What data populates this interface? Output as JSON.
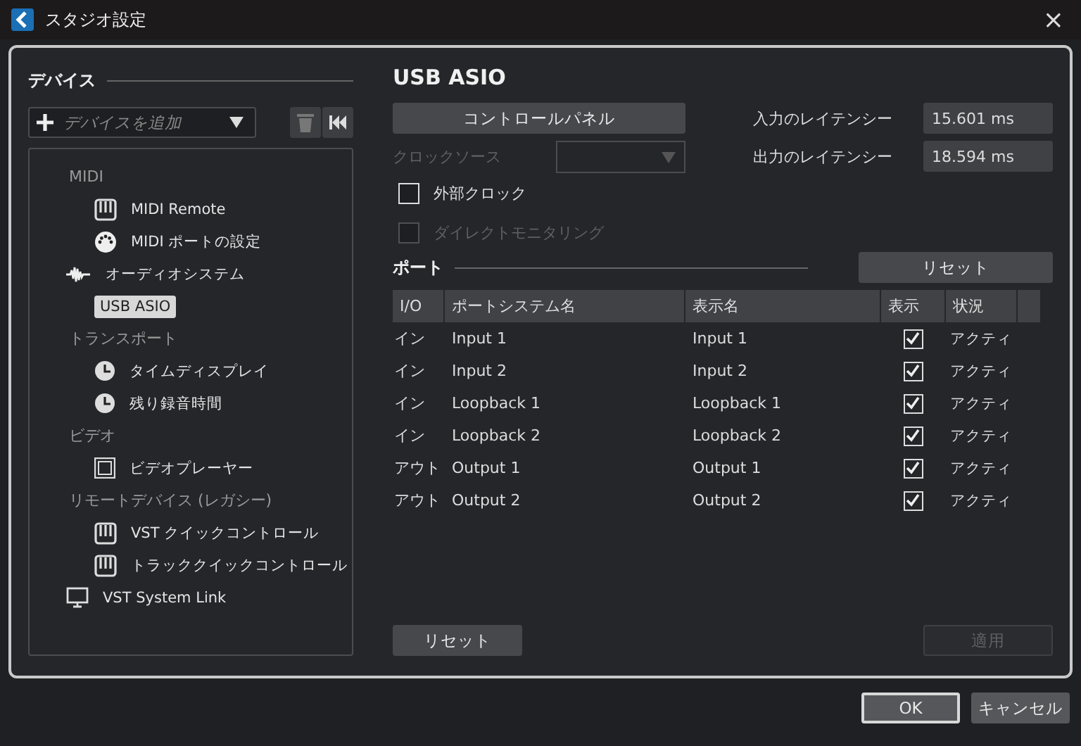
{
  "window": {
    "title": "スタジオ設定",
    "close": "×"
  },
  "devices": {
    "heading": "デバイス",
    "add_placeholder": "デバイスを追加",
    "tree": [
      {
        "label": "MIDI",
        "kind": "category",
        "selected": false,
        "children": [
          {
            "label": "MIDI Remote",
            "kind": "keyboard",
            "selected": false
          },
          {
            "label": "MIDI ポートの設定",
            "kind": "din",
            "selected": false
          }
        ]
      },
      {
        "label": "オーディオシステム",
        "kind": "wave",
        "selected": false,
        "children": [
          {
            "label": "USB ASIO",
            "kind": "plain",
            "selected": true
          }
        ]
      },
      {
        "label": "トランスポート",
        "kind": "category",
        "selected": false,
        "children": [
          {
            "label": "タイムディスプレイ",
            "kind": "clock",
            "selected": false
          },
          {
            "label": "残り録音時間",
            "kind": "clock",
            "selected": false
          }
        ]
      },
      {
        "label": "ビデオ",
        "kind": "category",
        "selected": false,
        "children": [
          {
            "label": "ビデオプレーヤー",
            "kind": "film",
            "selected": false
          }
        ]
      },
      {
        "label": "リモートデバイス (レガシー)",
        "kind": "category",
        "selected": false,
        "children": [
          {
            "label": "VST クイックコントロール",
            "kind": "keyboard",
            "selected": false
          },
          {
            "label": "トラッククイックコントロール",
            "kind": "keyboard",
            "selected": false
          }
        ]
      },
      {
        "label": "VST System Link",
        "kind": "monitor",
        "selected": false
      }
    ]
  },
  "driver": {
    "title": "USB ASIO",
    "control_panel": "コントロールパネル",
    "clock_source_label": "クロックソース",
    "clock_source_disabled": true,
    "input_latency_label": "入力のレイテンシー",
    "input_latency": "15.601 ms",
    "output_latency_label": "出力のレイテンシー",
    "output_latency": "18.594 ms",
    "options": [
      {
        "label": "外部クロック",
        "checked": false,
        "disabled": false
      },
      {
        "label": "ダイレクトモニタリング",
        "checked": false,
        "disabled": true
      }
    ]
  },
  "ports": {
    "heading": "ポート",
    "reset": "リセット",
    "columns": [
      "I/O",
      "ポートシステム名",
      "表示名",
      "表示",
      "状況"
    ],
    "rows": [
      {
        "io": "イン",
        "system_name": "Input 1",
        "display_name": "Input 1",
        "visible": true,
        "status": "アクティ"
      },
      {
        "io": "イン",
        "system_name": "Input 2",
        "display_name": "Input 2",
        "visible": true,
        "status": "アクティ"
      },
      {
        "io": "イン",
        "system_name": "Loopback 1",
        "display_name": "Loopback 1",
        "visible": true,
        "status": "アクティ"
      },
      {
        "io": "イン",
        "system_name": "Loopback 2",
        "display_name": "Loopback 2",
        "visible": true,
        "status": "アクティ"
      },
      {
        "io": "アウト",
        "system_name": "Output 1",
        "display_name": "Output 1",
        "visible": true,
        "status": "アクティ"
      },
      {
        "io": "アウト",
        "system_name": "Output 2",
        "display_name": "Output 2",
        "visible": true,
        "status": "アクティ"
      }
    ]
  },
  "panel_buttons": {
    "reset": "リセット",
    "apply": "適用",
    "apply_disabled": true
  },
  "buttons": [
    {
      "label": "OK",
      "default": true
    },
    {
      "label": "キャンセル",
      "default": false
    }
  ]
}
